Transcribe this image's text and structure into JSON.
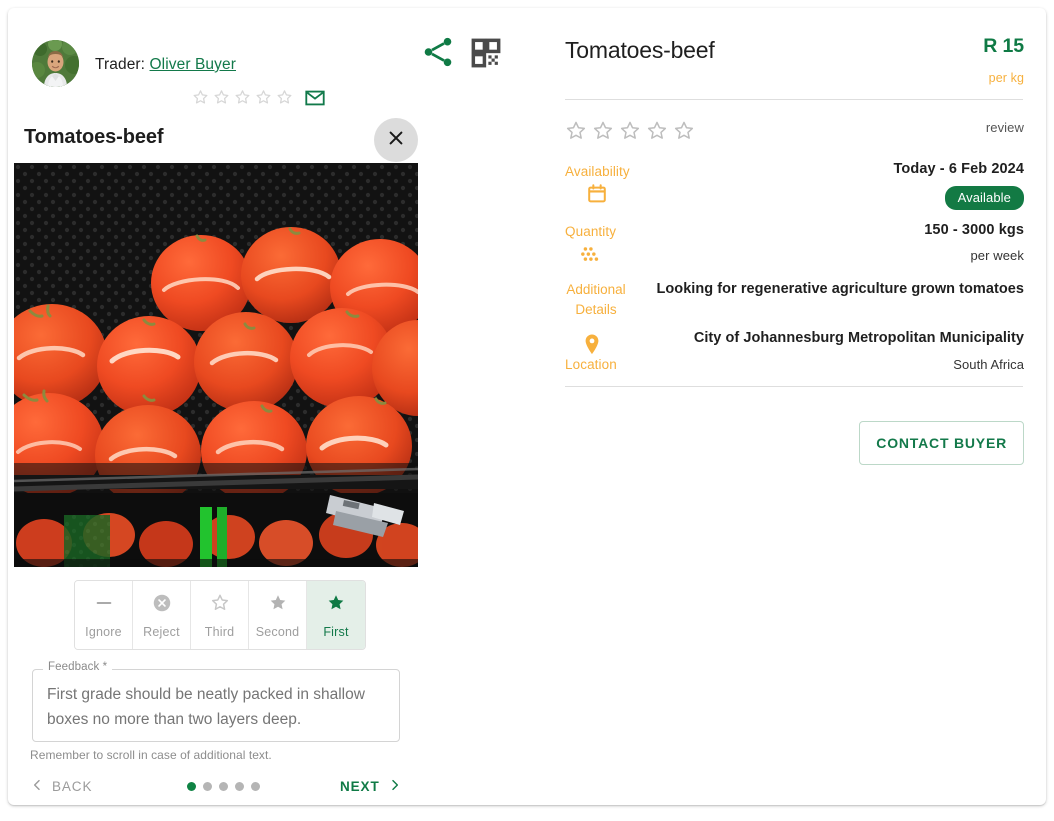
{
  "colors": {
    "brand_green": "#13794a",
    "accent_orange": "#f7b03d",
    "badge_green": "#137a44",
    "muted_grey": "#9e9e9e"
  },
  "trader": {
    "label": "Trader:",
    "name": "Oliver Buyer",
    "rating": 0,
    "stars_total": 5,
    "email_icon": "email-icon",
    "share_icon": "share-icon",
    "qr_icon": "qr-code-icon",
    "avatar_icon": "avatar"
  },
  "left": {
    "title": "Tomatoes-beef",
    "close_icon": "close-icon",
    "photo_alt": "Tomatoes-beef",
    "grades": [
      {
        "label": "Ignore",
        "icon": "dash-icon",
        "selected": false
      },
      {
        "label": "Reject",
        "icon": "cancel-circle-icon",
        "selected": false
      },
      {
        "label": "Third",
        "icon": "star-outline-icon",
        "selected": false
      },
      {
        "label": "Second",
        "icon": "star-filled-grey-icon",
        "selected": false
      },
      {
        "label": "First",
        "icon": "star-filled-icon",
        "selected": true
      }
    ],
    "feedback": {
      "legend": "Feedback *",
      "placeholder": "First grade should be neatly packed in shallow boxes no more than two layers deep.",
      "value": ""
    },
    "hint": "Remember to scroll in case of additional text.",
    "nav": {
      "back": "BACK",
      "next": "NEXT",
      "dots_total": 5,
      "dots_active_index": 0
    }
  },
  "right": {
    "title": "Tomatoes-beef",
    "price": "R 15",
    "price_unit": "per kg",
    "rating": 0,
    "stars_total": 5,
    "review_label": "review",
    "rows": [
      {
        "label": "Availability",
        "icon": "calendar-icon",
        "value": "Today - 6 Feb 2024",
        "badge": "Available"
      },
      {
        "label": "Quantity",
        "icon": "quantity-dots-icon",
        "value": "150 - 3000 kgs",
        "sub": "per week"
      },
      {
        "label": "Additional Details",
        "label_line1": "Additional",
        "label_line2": "Details",
        "value": "Looking for regenerative agriculture grown tomatoes"
      },
      {
        "label": "Location",
        "icon": "location-pin-icon",
        "value": "City of Johannesburg Metropolitan Municipality",
        "sub": "South Africa"
      }
    ],
    "contact_button": "CONTACT BUYER"
  }
}
